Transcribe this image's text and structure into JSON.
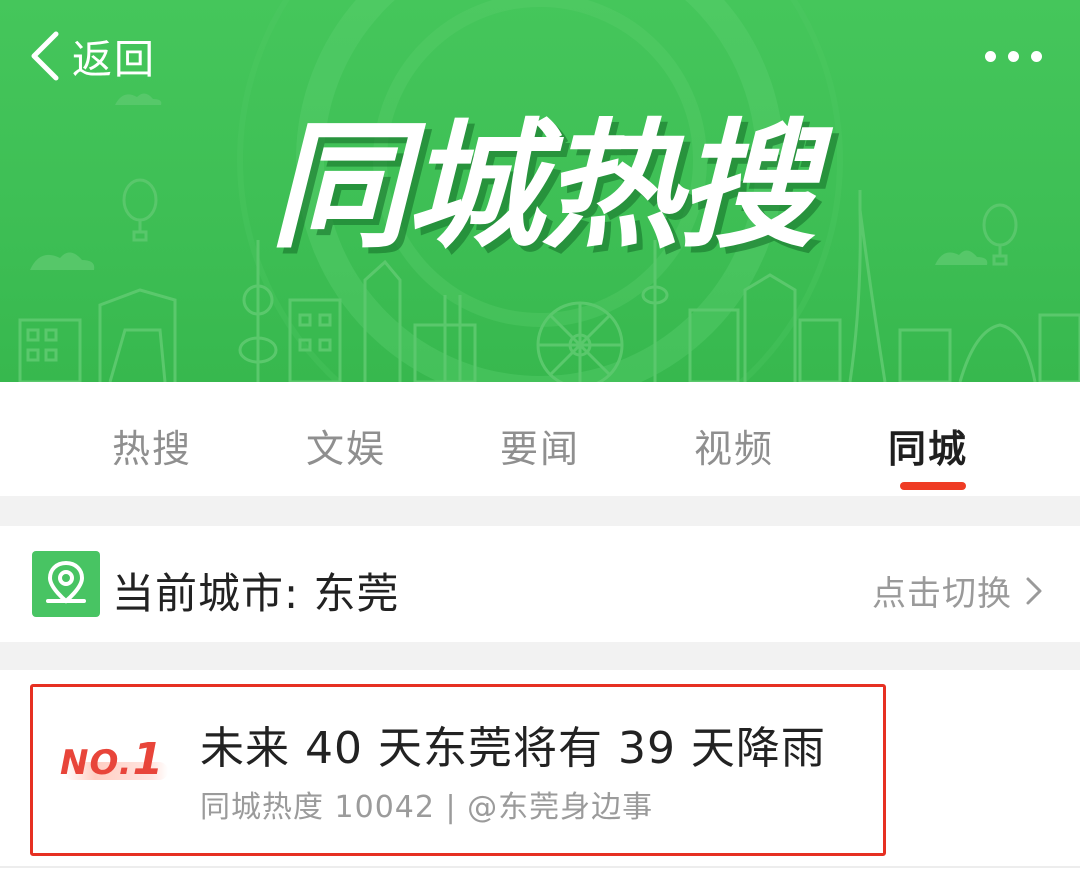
{
  "header": {
    "back_label": "返回",
    "banner_title": "同城热搜",
    "colors": {
      "banner_green": "#3ebf55",
      "accent_red": "#ef3c24"
    }
  },
  "tabs": [
    {
      "label": "热搜",
      "active": false
    },
    {
      "label": "文娱",
      "active": false
    },
    {
      "label": "要闻",
      "active": false
    },
    {
      "label": "视频",
      "active": false
    },
    {
      "label": "同城",
      "active": true
    }
  ],
  "city": {
    "label": "当前城市: 东莞",
    "switch_label": "点击切换"
  },
  "list": [
    {
      "rank_prefix": "NO.",
      "rank_number": "1",
      "title": "未来 40 天东莞将有 39 天降雨",
      "meta": "同城热度 10042 | @东莞身边事"
    }
  ]
}
